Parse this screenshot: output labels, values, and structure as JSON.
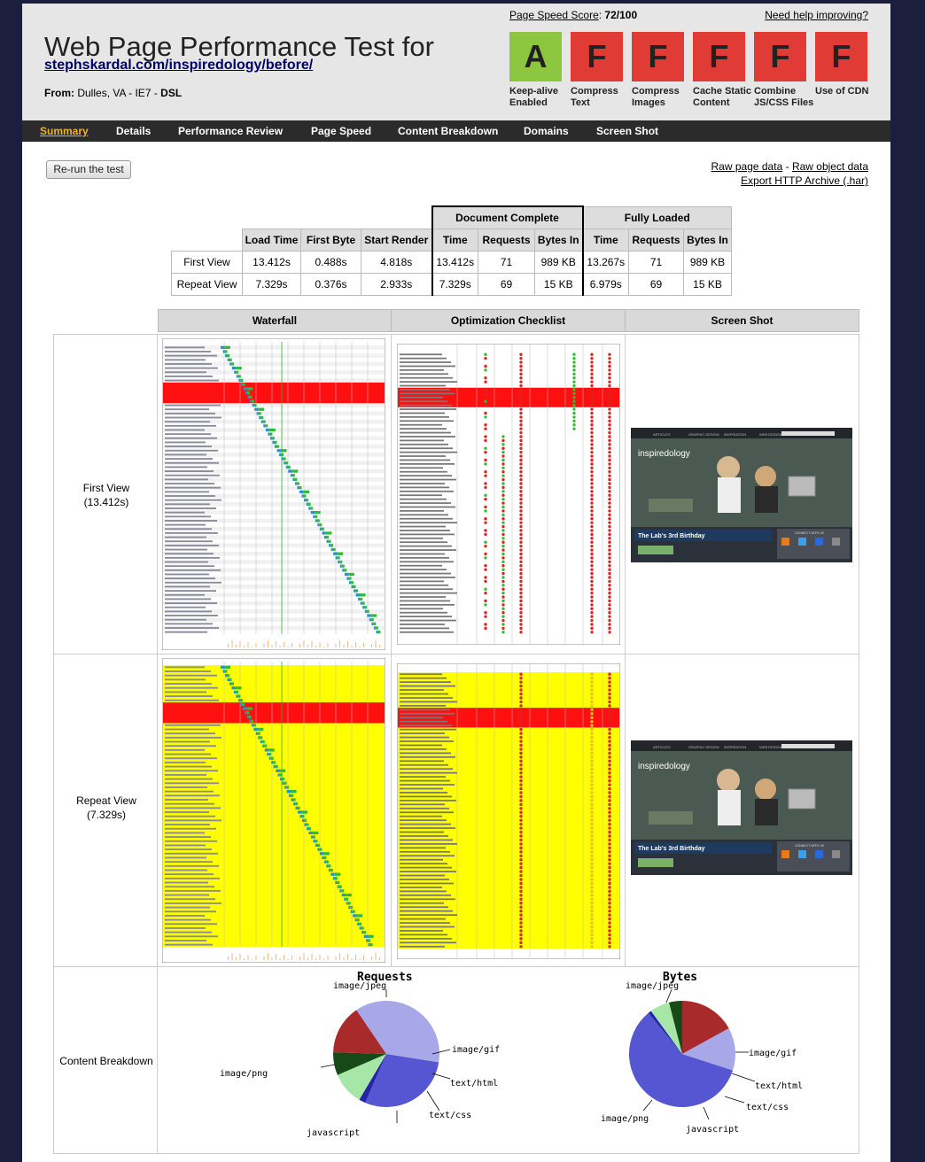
{
  "header": {
    "title": "Web Page Performance Test for",
    "url": "stephskardal.com/inspiredology/before/",
    "from_label": "From:",
    "from_location": "Dulles, VA - IE7 -",
    "from_connection": "DSL",
    "score_label": "Page Speed Score",
    "score_value": "72/100",
    "help_link": "Need help improving?"
  },
  "grades": [
    {
      "grade": "A",
      "label": "Keep-alive Enabled",
      "color": "#8dc63f"
    },
    {
      "grade": "F",
      "label": "Compress Text",
      "color": "#e03b34"
    },
    {
      "grade": "F",
      "label": "Compress Images",
      "color": "#e03b34"
    },
    {
      "grade": "F",
      "label": "Cache Static Content",
      "color": "#e03b34"
    },
    {
      "grade": "F",
      "label": "Combine JS/CSS Files",
      "color": "#e03b34"
    },
    {
      "grade": "F",
      "label": "Use of CDN",
      "color": "#e03b34"
    }
  ],
  "nav": [
    "Summary",
    "Details",
    "Performance Review",
    "Page Speed",
    "Content Breakdown",
    "Domains",
    "Screen Shot"
  ],
  "nav_active": "Summary",
  "actions": {
    "rerun": "Re-run the test",
    "raw_page": "Raw page data",
    "separator": "-",
    "raw_object": "Raw object data",
    "export": "Export HTTP Archive (.har)"
  },
  "stats": {
    "group_headers": [
      "Document Complete",
      "Fully Loaded"
    ],
    "headers": [
      "Load Time",
      "First Byte",
      "Start Render",
      "Time",
      "Requests",
      "Bytes In",
      "Time",
      "Requests",
      "Bytes In"
    ],
    "rows": [
      {
        "label": "First View",
        "values": [
          "13.412s",
          "0.488s",
          "4.818s",
          "13.412s",
          "71",
          "989 KB",
          "13.267s",
          "71",
          "989 KB"
        ]
      },
      {
        "label": "Repeat View",
        "values": [
          "7.329s",
          "0.376s",
          "2.933s",
          "7.329s",
          "69",
          "15 KB",
          "6.979s",
          "69",
          "15 KB"
        ]
      }
    ]
  },
  "grid": {
    "columns": [
      "Waterfall",
      "Optimization Checklist",
      "Screen Shot"
    ],
    "first_view": {
      "label": "First View",
      "time": "(13.412s)"
    },
    "repeat_view": {
      "label": "Repeat View",
      "time": "(7.329s)"
    },
    "content_breakdown": "Content Breakdown"
  },
  "screenshot": {
    "nav": [
      "ARTICLES",
      "GRAPHIC DESIGN",
      "INSPIRATION",
      "WEB DESIGN"
    ],
    "logo": "inspiredology",
    "headline": "The Lab's 3rd Birthday",
    "connect": "CONNECT WITH US"
  },
  "chart_data": [
    {
      "type": "pie",
      "title": "Requests",
      "labels": [
        "image/jpeg",
        "image/gif",
        "text/html",
        "text/css",
        "javascript",
        "image/png"
      ],
      "values": [
        29,
        2,
        10,
        7,
        15,
        37
      ],
      "colors": [
        "#5656d2",
        "#2424a8",
        "#a6e6a6",
        "#184a18",
        "#a82a2a",
        "#a8a8e8"
      ]
    },
    {
      "type": "pie",
      "title": "Bytes",
      "labels": [
        "image/jpeg",
        "image/gif",
        "text/html",
        "text/css",
        "javascript",
        "image/png"
      ],
      "values": [
        59,
        1,
        6,
        4,
        17,
        13
      ],
      "colors": [
        "#5656d2",
        "#2424a8",
        "#a6e6a6",
        "#184a18",
        "#a82a2a",
        "#a8a8e8"
      ]
    }
  ]
}
